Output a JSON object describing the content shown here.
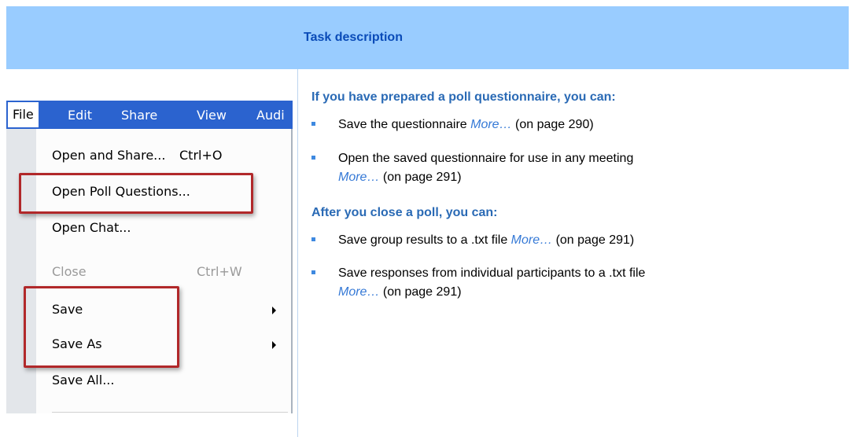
{
  "header": {
    "title": "Task description"
  },
  "menu": {
    "menubar": [
      "File",
      "Edit",
      "Share",
      "View",
      "Audi"
    ],
    "items": [
      {
        "label": "Open and Share...",
        "shortcut": "Ctrl+O"
      },
      {
        "label": "Open Poll Questions..."
      },
      {
        "label": "Open Chat..."
      },
      {
        "label": "Close",
        "shortcut": "Ctrl+W"
      },
      {
        "label": "Save"
      },
      {
        "label": "Save As"
      },
      {
        "label": "Save All..."
      }
    ]
  },
  "section1": {
    "heading": "If you have prepared a poll questionnaire, you can:",
    "bullets": [
      {
        "text": "Save the questionnaire",
        "more": "More…",
        "ref": "(on page 290)"
      },
      {
        "text": "Open the saved questionnaire for use in any meeting",
        "more": "More…",
        "ref": "(on page 291)"
      }
    ]
  },
  "section2": {
    "heading": "After you close a poll, you can:",
    "bullets": [
      {
        "text": "Save group results to a .txt file",
        "more": "More…",
        "ref": "(on page 291)"
      },
      {
        "text": "Save responses from individual participants to a .txt file",
        "more": "More…",
        "ref": "(on page 291)"
      }
    ]
  },
  "colors": {
    "header_bg": "#99ccff",
    "heading": "#2a6ab5",
    "link": "#3579d6",
    "highlight": "#b1282a",
    "menubar": "#2b63cf"
  }
}
